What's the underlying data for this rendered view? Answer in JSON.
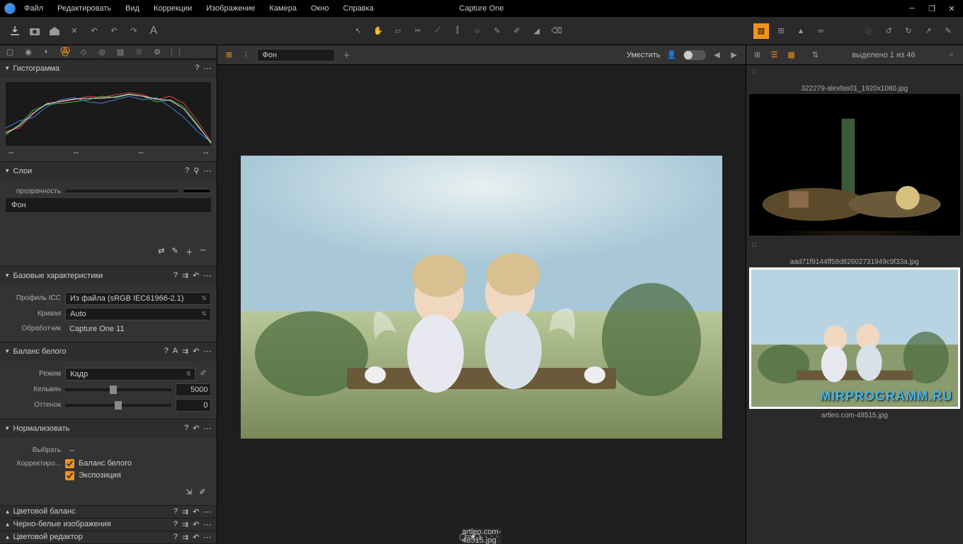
{
  "app_title": "Capture One",
  "menu": [
    "Файл",
    "Редактировать",
    "Вид",
    "Коррекции",
    "Изображение",
    "Камера",
    "Окно",
    "Справка"
  ],
  "center_toolbar": {
    "layer_label": "Фон",
    "fit_label": "Уместить"
  },
  "browser": {
    "selection_text": "выделено 1 из 46",
    "thumbs": [
      {
        "name": "322279-alexfas01_1920x1080.jpg",
        "selected": false
      },
      {
        "name": "aad71f9144ff58d82602731949c9f33a.jpg",
        "selected": true
      },
      {
        "name": "artleo.com-48515.jpg",
        "selected": false
      }
    ]
  },
  "image_caption": "artleo.com-48515.jpg",
  "panels": {
    "histogram": {
      "title": "Гистограмма",
      "labels": [
        "--",
        "--",
        "--",
        "--"
      ]
    },
    "layers": {
      "title": "Слои",
      "opacity_label": "прозрачность",
      "bg_label": "Фон"
    },
    "basic": {
      "title": "Базовые характеристики",
      "icc_label": "Профиль ICC",
      "icc_value": "Из файла (sRGB IEC61966-2.1)",
      "curve_label": "Кривая",
      "curve_value": "Auto",
      "engine_label": "Обработчик",
      "engine_value": "Capture One 11"
    },
    "wb": {
      "title": "Баланс белого",
      "mode_label": "Режим",
      "mode_value": "Кадр",
      "kelvin_label": "Кельвин",
      "kelvin_value": "5000",
      "tint_label": "Оттенок",
      "tint_value": "0"
    },
    "normalize": {
      "title": "Нормализовать",
      "select_label": "Выбрать",
      "select_value": "--",
      "adjust_label": "Корректиро...",
      "wb_check": "Баланс белого",
      "exp_check": "Экспозиция"
    },
    "collapsed": [
      "Цветовой баланс",
      "Черно-белые изображения",
      "Цветовой редактор"
    ]
  },
  "watermark": "MIRPROGRAMM.RU"
}
